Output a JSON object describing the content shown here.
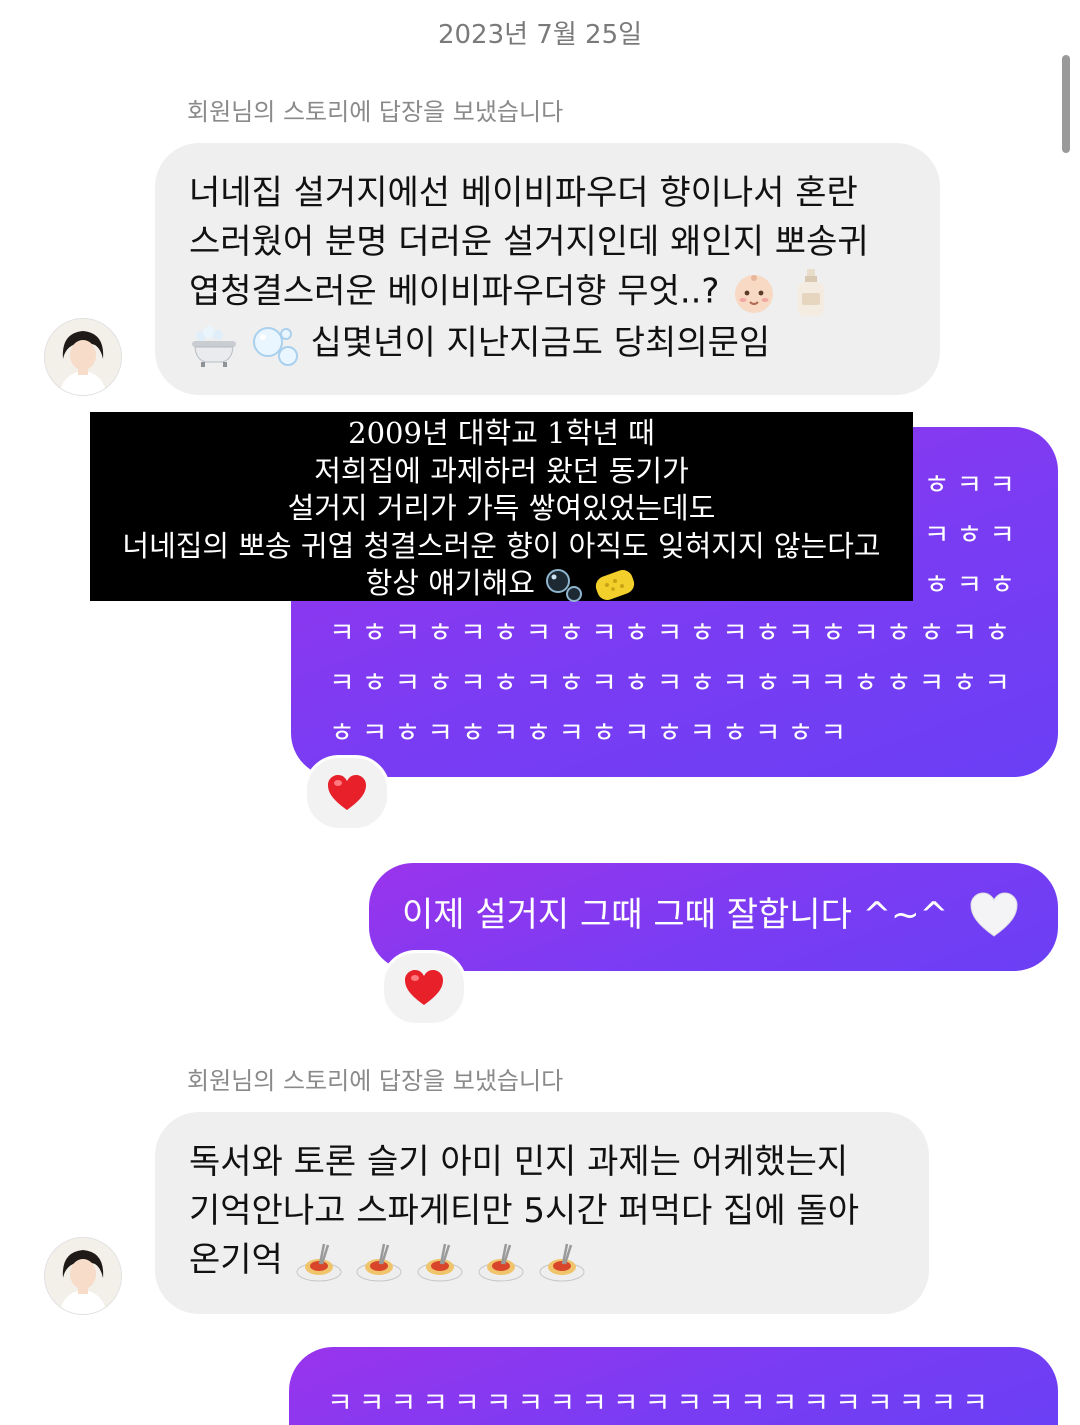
{
  "chat": {
    "date_divider": "2023년 7월 25일",
    "story_reply_note_1": "회원님의 스토리에 답장을 보냈습니다",
    "incoming_1": {
      "lines": [
        "너네집 설거지에선 베이비파우더 향이나서 혼란",
        "스러웠어 분명 더러운 설거지인데 왜인지 뽀송귀",
        "엽청결스러운 베이비파우더향 무엇..?",
        "십몇년이 지난지금도 당최의문임"
      ],
      "emoji_icons": [
        "baby-face-icon",
        "lotion-bottle-icon",
        "bathtub-icon",
        "bubbles-icon"
      ]
    },
    "outgoing_1": {
      "visible_lines_right": [
        "ㅎㅋㅋ",
        "ㅋㅎㅋ",
        "ㅎㅋㅎ"
      ],
      "lines": [
        "ㅋㅎㅋㅎㅋㅎㅋㅎㅋㅎㅋㅎㅋㅎㅋㅎㅋㅎㅎㅋㅎ",
        "ㅋㅎㅋㅎㅋㅎㅋㅎㅋㅎㅋㅎㅋㅎㅋㅋㅎㅎㅋㅎㅋ",
        "ㅎㅋㅎㅋㅎㅋㅎㅋㅎㅋㅎㅋㅎㅋㅎㅋ"
      ],
      "reaction": "heart-icon"
    },
    "outgoing_2": {
      "text": "이제 설거지 그때 그때 잘합니다 ^~^",
      "emoji": "white-heart-icon",
      "reaction": "heart-icon"
    },
    "story_reply_note_2": "회원님의 스토리에 답장을 보냈습니다",
    "incoming_2": {
      "lines": [
        "독서와 토론 슬기 아미 민지 과제는 어케했는지",
        "기억안나고 스파게티만 5시간 퍼먹다 집에 돌아",
        "온기억"
      ],
      "emoji_icons": [
        "spaghetti-icon",
        "spaghetti-icon",
        "spaghetti-icon",
        "spaghetti-icon",
        "spaghetti-icon"
      ]
    },
    "outgoing_3": {
      "line": "ㅋㅋㅋㅋㅋㅋㅋㅋㅋㅋㅋㅋㅋㅋㅋㅋㅋㅋㅋㅋㅋ"
    }
  },
  "caption": {
    "lines": [
      "2009년 대학교 1학년 때",
      "저희집에 과제하러 왔던 동기가",
      "설거지 거리가 가득 쌓여있었는데도",
      "너네집의 뽀송 귀엽 청결스러운 향이 아직도 잊혀지지 않는다고",
      "항상 얘기해요"
    ],
    "emoji_icons": [
      "bubbles-icon",
      "sponge-icon"
    ]
  },
  "colors": {
    "outgoing_bubble": "#7a3cf3",
    "incoming_bubble": "#efefef",
    "meta_text": "#8a8a8a",
    "reaction_heart": "#e8202a"
  }
}
